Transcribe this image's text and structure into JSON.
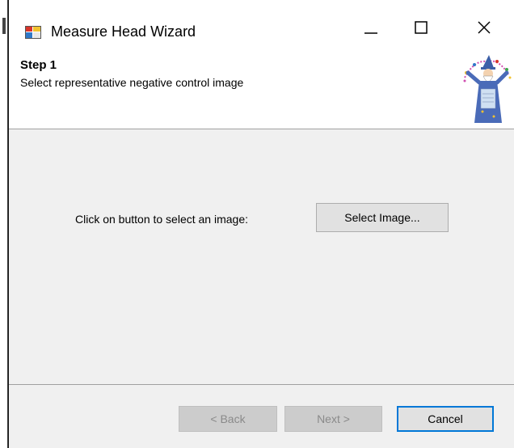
{
  "window": {
    "title": "Measure Head Wizard"
  },
  "header": {
    "step_title": "Step 1",
    "step_description": "Select representative negative control image"
  },
  "content": {
    "prompt": "Click on button to select an image:",
    "select_button_label": "Select Image..."
  },
  "footer": {
    "back_label": "< Back",
    "next_label": "Next >",
    "cancel_label": "Cancel",
    "back_enabled": false,
    "next_enabled": false
  },
  "icons": {
    "app": "app-window-icon",
    "minimize": "minimize-icon",
    "maximize": "maximize-icon",
    "close": "close-icon",
    "wizard": "wizard-icon"
  },
  "colors": {
    "accent": "#0078d7",
    "panel": "#f0f0f0",
    "header": "#ffffff"
  }
}
